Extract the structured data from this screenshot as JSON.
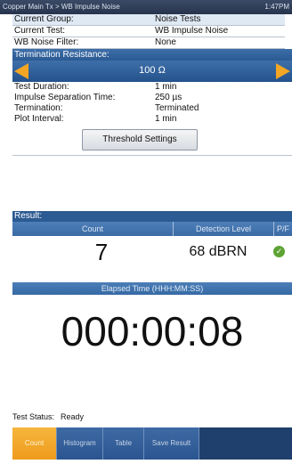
{
  "titlebar": {
    "title": "Copper Main Tx > WB Impulse Noise",
    "status": "1:47PM"
  },
  "info": [
    {
      "label": "Current Group:",
      "value": "Noise Tests"
    },
    {
      "label": "Current Test:",
      "value": "WB Impulse Noise"
    },
    {
      "label": "WB Noise Filter:",
      "value": "None"
    }
  ],
  "termination": {
    "label": "Termination Resistance:",
    "value": "100 Ω"
  },
  "info2": [
    {
      "label": "Test Duration:",
      "value": "1 min"
    },
    {
      "label": "Impulse Separation Time:",
      "value": "250 µs"
    },
    {
      "label": "Termination:",
      "value": "Terminated"
    },
    {
      "label": "Plot Interval:",
      "value": "1 min"
    }
  ],
  "threshold_button": "Threshold Settings",
  "result": {
    "header": "Result:",
    "columns": [
      "Count",
      "Detection Level",
      "P/F"
    ],
    "count": "7",
    "level": "68 dBRN",
    "pf": "pass"
  },
  "elapsed": {
    "label": "Elapsed Time (HHH:MM:SS)",
    "value": "000:00:08"
  },
  "status": {
    "label": "Test Status:",
    "value": "Ready"
  },
  "tabs": [
    "Count",
    "Histogram",
    "Table",
    "Save Result"
  ],
  "icons": {
    "pass": "check-icon",
    "left": "arrow-left-icon",
    "right": "arrow-right-icon"
  },
  "colors": {
    "accent": "#f2a623",
    "header": "#2c5a92",
    "pass": "#5da334"
  }
}
